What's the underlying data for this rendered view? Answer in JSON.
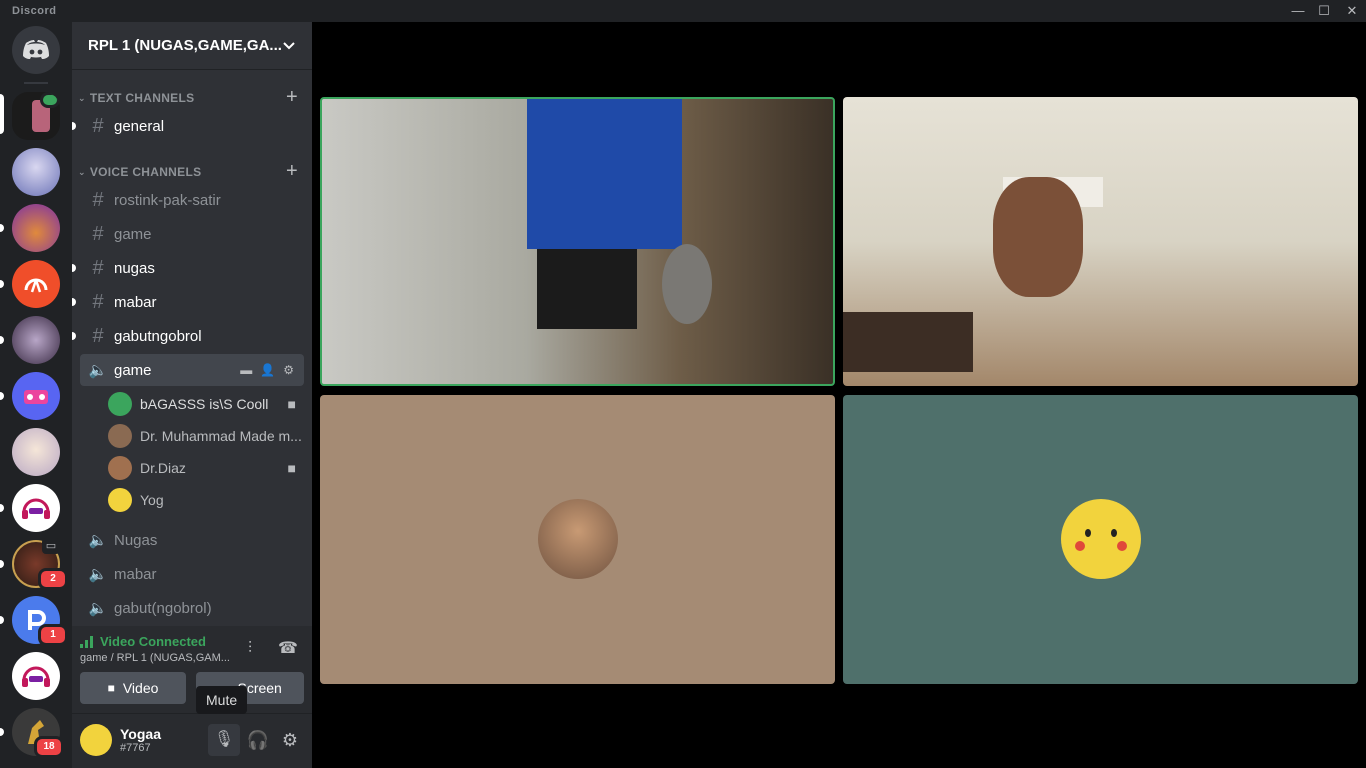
{
  "window": {
    "app_name": "Discord",
    "minimize": "—",
    "maximize": "☐",
    "close": "✕"
  },
  "guild": {
    "name": "RPL 1 (NUGAS,GAME,GA..."
  },
  "categories": {
    "text": "TEXT CHANNELS",
    "voice": "VOICE CHANNELS"
  },
  "channels": [
    {
      "name": "general",
      "type": "text"
    },
    {
      "name": "rostink-pak-satir",
      "type": "text"
    },
    {
      "name": "game",
      "type": "text"
    },
    {
      "name": "nugas",
      "type": "text"
    },
    {
      "name": "mabar",
      "type": "text"
    },
    {
      "name": "gabutngobrol",
      "type": "text"
    },
    {
      "name": "game",
      "type": "voice"
    },
    {
      "name": "Nugas",
      "type": "voice"
    },
    {
      "name": "mabar",
      "type": "voice"
    },
    {
      "name": "gabut(ngobrol)",
      "type": "voice"
    }
  ],
  "voice_users": [
    {
      "name": "bAGASSS is\\S Cooll"
    },
    {
      "name": "Dr. Muhammad Made m..."
    },
    {
      "name": "Dr.Diaz"
    },
    {
      "name": "Yog"
    }
  ],
  "voice_status": {
    "title": "Video Connected",
    "subtitle": "game / RPL 1 (NUGAS,GAM...",
    "video_label": "Video",
    "screen_label": "Screen"
  },
  "user": {
    "name": "Yogaa",
    "tag": "#7767"
  },
  "tooltip": {
    "text": "Mute"
  },
  "badges": {
    "server9": "2",
    "server10": "1",
    "server12": "18"
  },
  "colors": {
    "accent": "#3ba55d",
    "tile_brown": "#a58b74",
    "tile_teal": "#4f706b",
    "unread_badge": "#ed4245"
  }
}
